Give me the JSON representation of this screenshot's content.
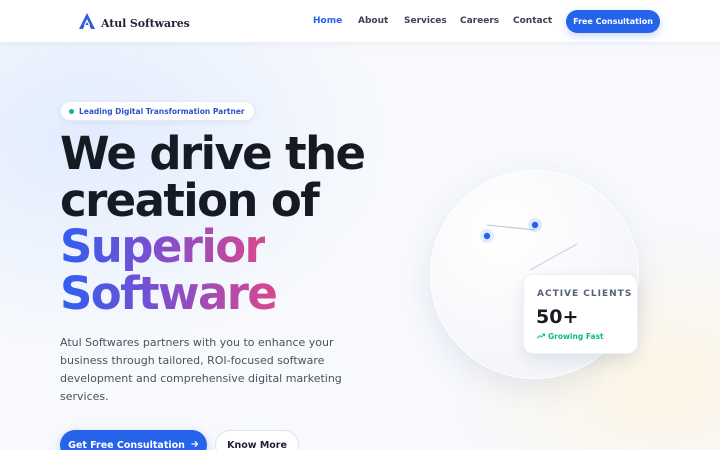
{
  "header": {
    "brand": "Atul Softwares",
    "nav": [
      {
        "label": "Home",
        "active": true
      },
      {
        "label": "About",
        "active": false
      },
      {
        "label": "Services",
        "active": false
      },
      {
        "label": "Careers",
        "active": false
      },
      {
        "label": "Contact",
        "active": false
      }
    ],
    "cta_label": "Free Consultation"
  },
  "hero": {
    "badge": "Leading Digital Transformation Partner",
    "headline": {
      "line1": "We drive the",
      "line2": "creation of",
      "line3": "Superior",
      "line4": "Software"
    },
    "description": "Atul Softwares partners with you to enhance your business through tailored, ROI-focused software development and comprehensive digital marketing services.",
    "primary_button": "Get Free Consultation",
    "secondary_button": "Know More"
  },
  "stat_card": {
    "label": "ACTIVE CLIENTS",
    "value": "50+",
    "trend": "Growing Fast"
  },
  "colors": {
    "accent": "#2563eb",
    "success": "#10b981",
    "headline_dark": "#161a22",
    "gradient_start": "#2f5ff0",
    "gradient_end": "#d9488d"
  },
  "icons": {
    "logo": "triangle-a-logo-icon",
    "button_arrow": "arrow-right-icon",
    "trend": "trend-up-icon",
    "badge_dot": "status-dot-icon"
  }
}
